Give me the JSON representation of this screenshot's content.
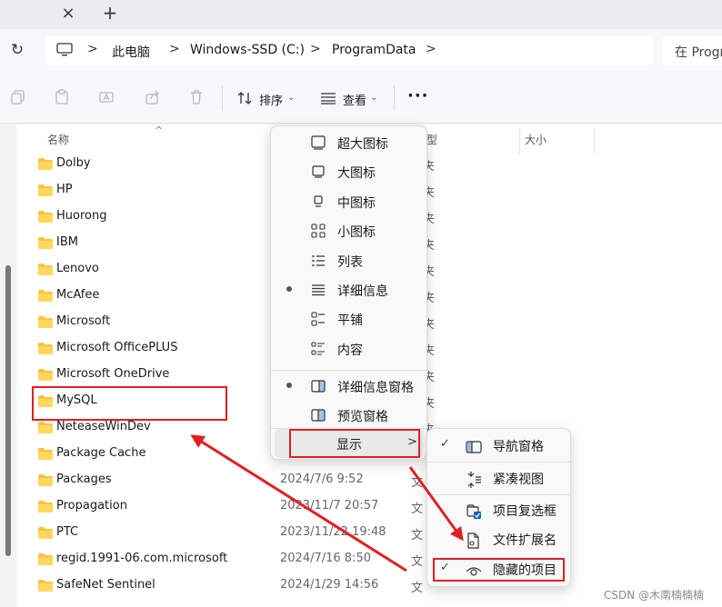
{
  "address": {
    "crumbs": [
      "此电脑",
      "Windows-SSD (C:)",
      "ProgramData"
    ],
    "search_placeholder": "在 Progr"
  },
  "toolbar": {
    "sort_label": "排序",
    "view_label": "查看",
    "more_label": "···"
  },
  "columns": {
    "name": "名称",
    "type": "型",
    "size": "大小"
  },
  "files": [
    {
      "name": "Dolby",
      "date": "",
      "type": "件夹"
    },
    {
      "name": "HP",
      "date": "",
      "type": "件夹"
    },
    {
      "name": "Huorong",
      "date": "",
      "type": "件夹"
    },
    {
      "name": "IBM",
      "date": "",
      "type": "件夹"
    },
    {
      "name": "Lenovo",
      "date": "",
      "type": "件夹"
    },
    {
      "name": "McAfee",
      "date": "",
      "type": "件夹"
    },
    {
      "name": "Microsoft",
      "date": "",
      "type": "件夹"
    },
    {
      "name": "Microsoft OfficePLUS",
      "date": "",
      "type": "件夹"
    },
    {
      "name": "Microsoft OneDrive",
      "date": "",
      "type": "件夹"
    },
    {
      "name": "MySQL",
      "date": "",
      "type": "件夹"
    },
    {
      "name": "NeteaseWinDev",
      "date": "",
      "type": "件夹"
    },
    {
      "name": "Package Cache",
      "date": "",
      "type": ""
    },
    {
      "name": "Packages",
      "date": "2024/7/6 9:52",
      "type": "文"
    },
    {
      "name": "Propagation",
      "date": "2023/11/7 20:57",
      "type": "文"
    },
    {
      "name": "PTC",
      "date": "2023/11/22 19:48",
      "type": "文"
    },
    {
      "name": "regid.1991-06.com.microsoft",
      "date": "2024/7/16 8:50",
      "type": "文"
    },
    {
      "name": "SafeNet Sentinel",
      "date": "2024/1/29 14:56",
      "type": "文"
    }
  ],
  "view_menu": {
    "items": [
      {
        "label": "超大图标",
        "icon": "extra-large-icons-icon",
        "selected": false
      },
      {
        "label": "大图标",
        "icon": "large-icons-icon",
        "selected": false
      },
      {
        "label": "中图标",
        "icon": "medium-icons-icon",
        "selected": false
      },
      {
        "label": "小图标",
        "icon": "small-icons-icon",
        "selected": false
      },
      {
        "label": "列表",
        "icon": "list-icon",
        "selected": false
      },
      {
        "label": "详细信息",
        "icon": "details-icon",
        "selected": true
      },
      {
        "label": "平铺",
        "icon": "tiles-icon",
        "selected": false
      },
      {
        "label": "内容",
        "icon": "content-icon",
        "selected": false
      }
    ],
    "pane_items": [
      {
        "label": "详细信息窗格",
        "icon": "details-pane-icon",
        "selected": true
      },
      {
        "label": "预览窗格",
        "icon": "preview-pane-icon",
        "selected": false
      }
    ],
    "show_label": "显示"
  },
  "show_submenu": {
    "items": [
      {
        "label": "导航窗格",
        "icon": "navigation-pane-icon",
        "checked": true
      },
      {
        "label": "紧凑视图",
        "icon": "compact-view-icon",
        "checked": false
      },
      {
        "label": "项目复选框",
        "icon": "item-checkbox-icon",
        "checked": false
      },
      {
        "label": "文件扩展名",
        "icon": "file-extension-icon",
        "checked": false
      },
      {
        "label": "隐藏的项目",
        "icon": "hidden-items-icon",
        "checked": true
      }
    ],
    "check_glyph": "✓"
  },
  "watermark": "CSDN @木南楠楠楠",
  "colors": {
    "accent": "#0067c0",
    "folder": "#f4c542",
    "annotation": "#e02020"
  }
}
